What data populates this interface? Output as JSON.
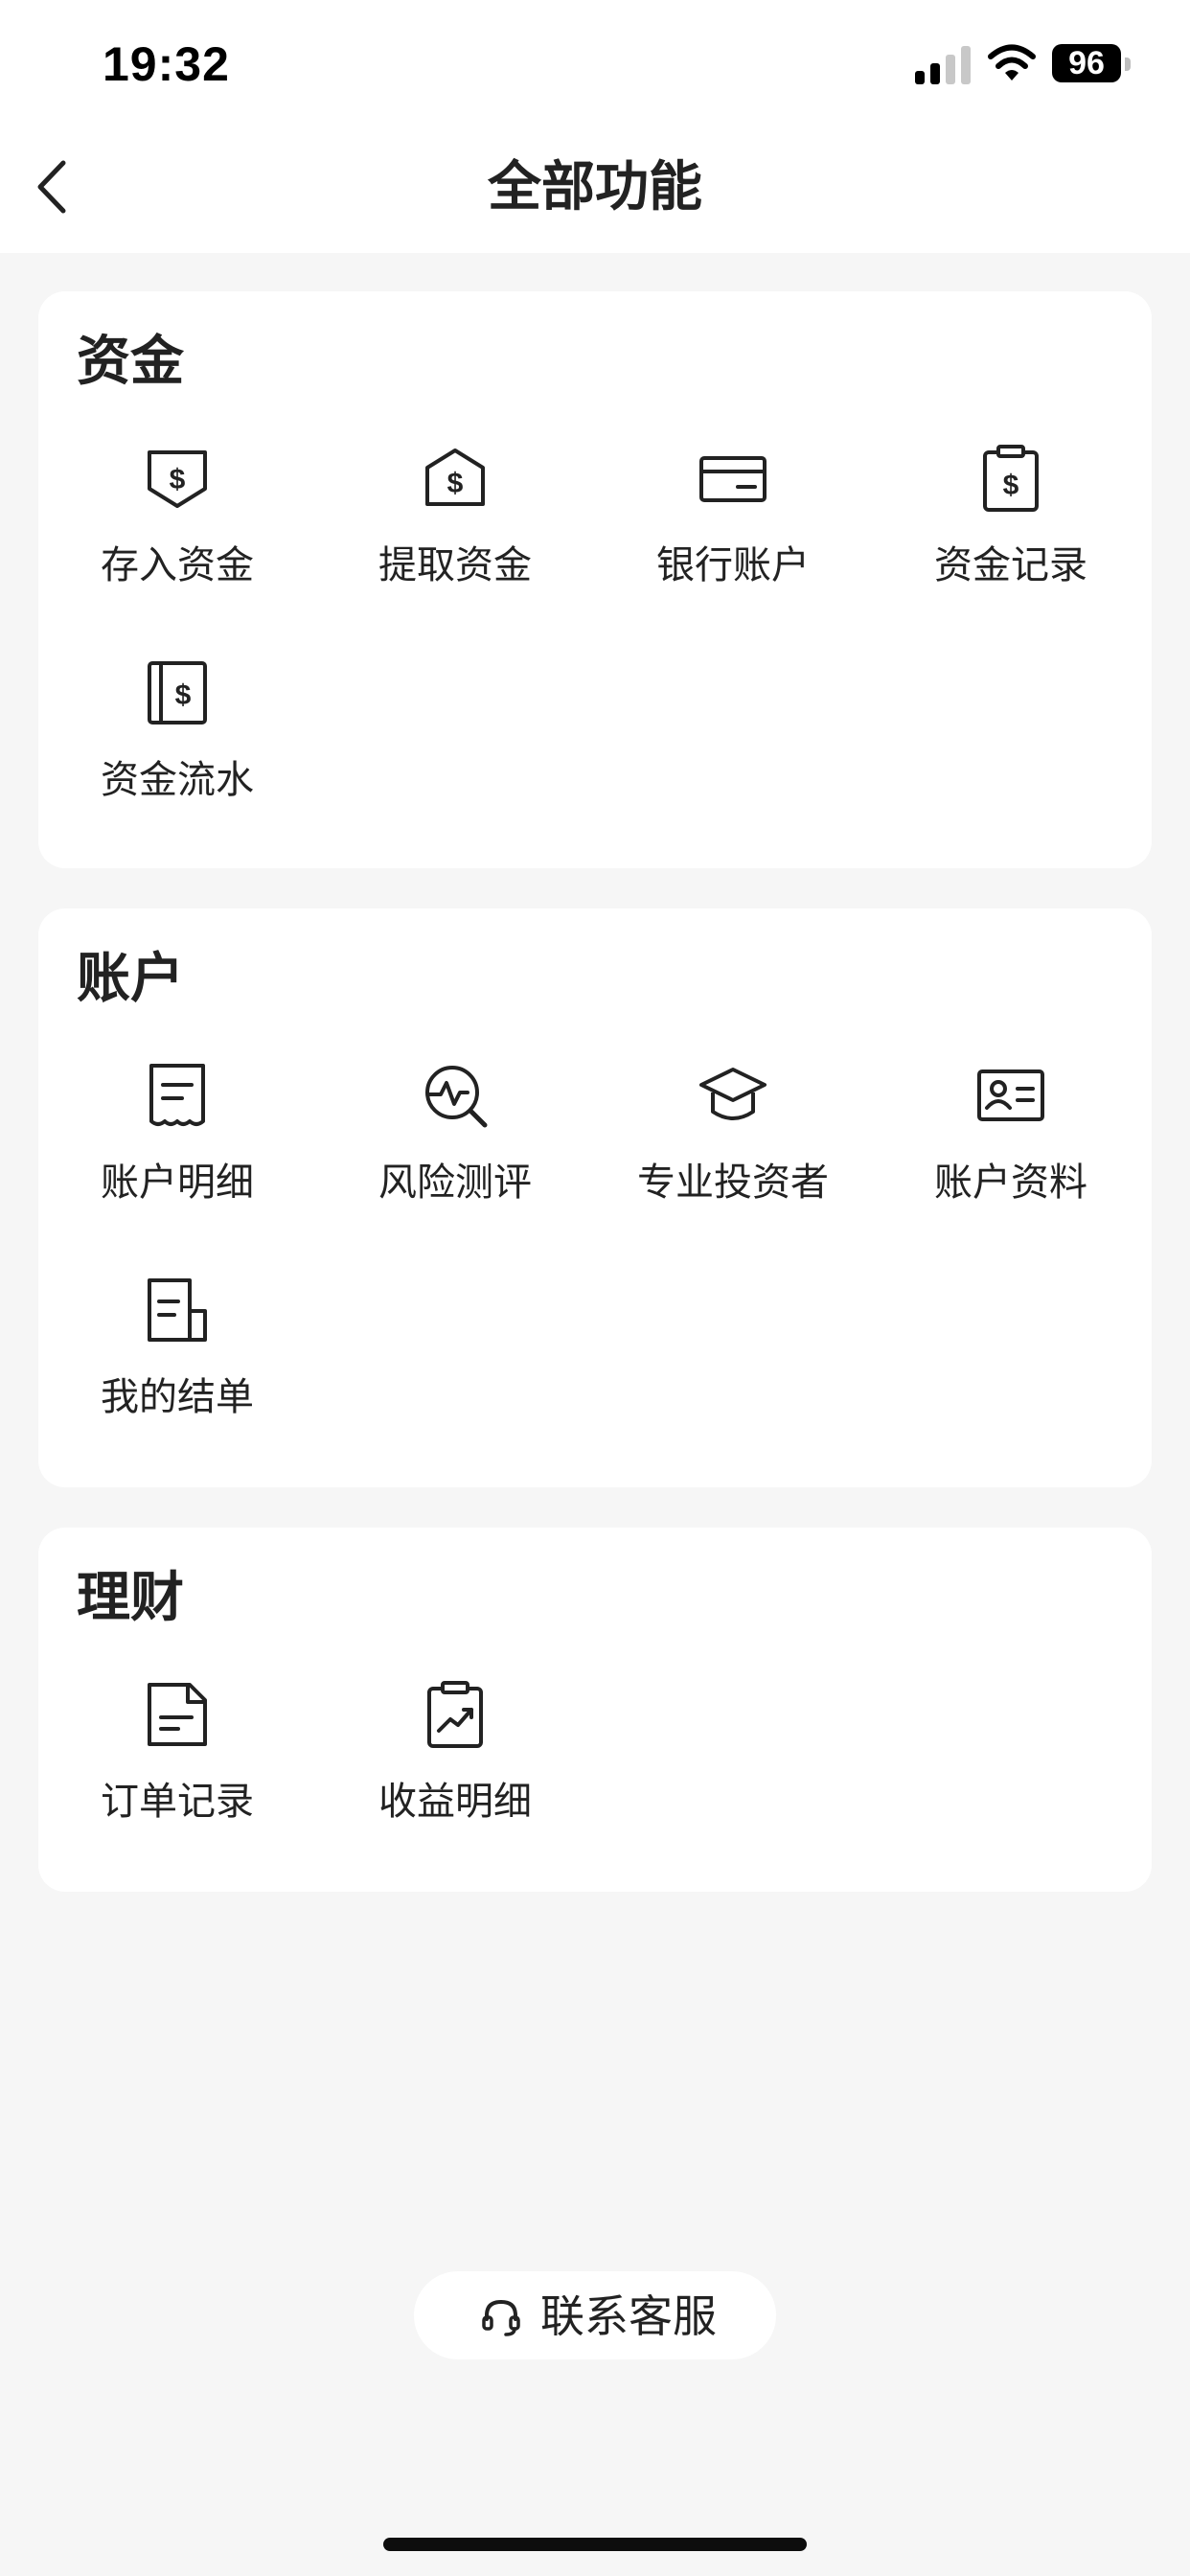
{
  "status_bar": {
    "time": "19:32",
    "battery": "96"
  },
  "header": {
    "title": "全部功能"
  },
  "sections": [
    {
      "title": "资金",
      "items": [
        {
          "label": "存入资金",
          "icon": "deposit-icon"
        },
        {
          "label": "提取资金",
          "icon": "withdraw-icon"
        },
        {
          "label": "银行账户",
          "icon": "bank-card-icon"
        },
        {
          "label": "资金记录",
          "icon": "fund-record-icon"
        },
        {
          "label": "资金流水",
          "icon": "fund-flow-icon"
        }
      ]
    },
    {
      "title": "账户",
      "items": [
        {
          "label": "账户明细",
          "icon": "receipt-icon"
        },
        {
          "label": "风险测评",
          "icon": "risk-search-icon"
        },
        {
          "label": "专业投资者",
          "icon": "graduation-cap-icon"
        },
        {
          "label": "账户资料",
          "icon": "id-card-icon"
        },
        {
          "label": "我的结单",
          "icon": "statement-icon"
        }
      ]
    },
    {
      "title": "理财",
      "items": [
        {
          "label": "订单记录",
          "icon": "order-doc-icon"
        },
        {
          "label": "收益明细",
          "icon": "chart-clipboard-icon"
        }
      ]
    }
  ],
  "support": {
    "label": "联系客服",
    "icon": "headset-icon"
  }
}
